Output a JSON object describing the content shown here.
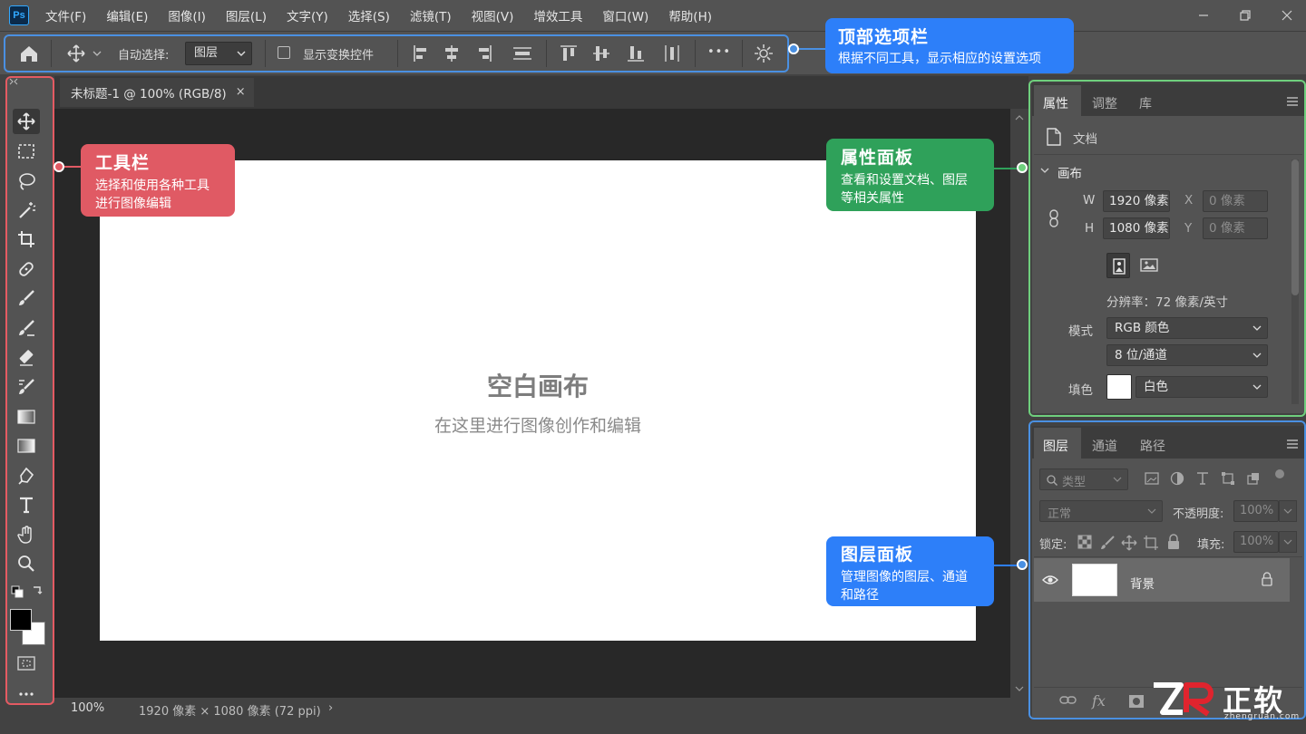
{
  "app": {
    "logo": "Ps"
  },
  "menu": [
    "文件(F)",
    "编辑(E)",
    "图像(I)",
    "图层(L)",
    "文字(Y)",
    "选择(S)",
    "滤镜(T)",
    "视图(V)",
    "增效工具",
    "窗口(W)",
    "帮助(H)"
  ],
  "options": {
    "auto_select_label": "自动选择:",
    "layer_select_value": "图层",
    "show_transform_label": "显示变换控件",
    "more_label": "•••"
  },
  "document": {
    "tab_title": "未标题-1 @ 100% (RGB/8)",
    "tab_close": "×",
    "canvas_title": "空白画布",
    "canvas_subtitle": "在这里进行图像创作和编辑"
  },
  "status": {
    "zoom": "100%",
    "doc_size": "1920 像素 × 1080 像素 (72 ppi)",
    "arrow": "›"
  },
  "properties": {
    "tabs": [
      "属性",
      "调整",
      "库"
    ],
    "doc_label": "文档",
    "section_canvas": "画布",
    "w_label": "W",
    "w_value": "1920 像素",
    "h_label": "H",
    "h_value": "1080 像素",
    "x_label": "X",
    "x_value": "0 像素",
    "y_label": "Y",
    "y_value": "0 像素",
    "resolution": "分辨率：72 像素/英寸",
    "mode_label": "模式",
    "mode_value": "RGB 颜色",
    "bits_value": "8 位/通道",
    "fill_label": "填色",
    "fill_value": "白色"
  },
  "layers": {
    "tabs": [
      "图层",
      "通道",
      "路径"
    ],
    "filter_placeholder": "类型",
    "blend_mode": "正常",
    "opacity_label": "不透明度:",
    "opacity_value": "100%",
    "lock_label": "锁定:",
    "fill_label": "填充:",
    "fill_value": "100%",
    "layer_name": "背景",
    "footer_fx": "fx"
  },
  "callouts": {
    "options_bar": {
      "title": "顶部选项栏",
      "desc": "根据不同工具，显示相应的设置选项"
    },
    "toolbar": {
      "title": "工具栏",
      "desc": "选择和使用各种工具\n进行图像编辑"
    },
    "properties": {
      "title": "属性面板",
      "desc": "查看和设置文档、图层\n等相关属性"
    },
    "layers": {
      "title": "图层面板",
      "desc": "管理图像的图层、通道\n和路径"
    }
  },
  "watermark": {
    "brand": "正软",
    "url": "zhengruan.com"
  },
  "colors": {
    "blue": "#4a90e2",
    "red": "#e05a64",
    "green": "#2fa15a",
    "callout_blue": "#2d7ff9"
  }
}
